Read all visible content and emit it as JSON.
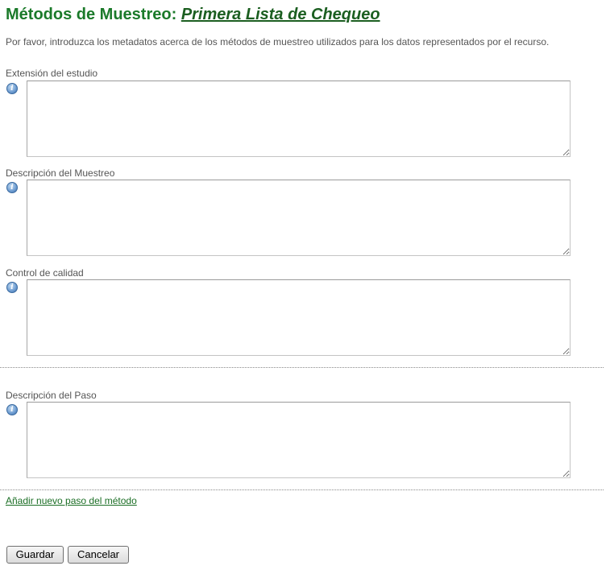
{
  "header": {
    "title_prefix": "Métodos de Muestreo:",
    "title_link": "Primera Lista de Chequeo"
  },
  "intro": "Por favor, introduzca los metadatos acerca de los métodos de muestreo utilizados para los datos representados por el recurso.",
  "fields": [
    {
      "label": "Extensión del estudio",
      "value": "",
      "icon": "info-icon"
    },
    {
      "label": "Descripción del Muestreo",
      "value": "",
      "icon": "info-icon"
    },
    {
      "label": "Control de calidad",
      "value": "",
      "icon": "info-icon"
    },
    {
      "label": "Descripción del Paso",
      "value": "",
      "icon": "info-icon"
    }
  ],
  "icon_glyph": "i",
  "add_step_link": "Añadir nuevo paso del método",
  "buttons": {
    "save": "Guardar",
    "cancel": "Cancelar"
  },
  "colors": {
    "title_green": "#1b7a2a",
    "link_green": "#1b6e25"
  }
}
